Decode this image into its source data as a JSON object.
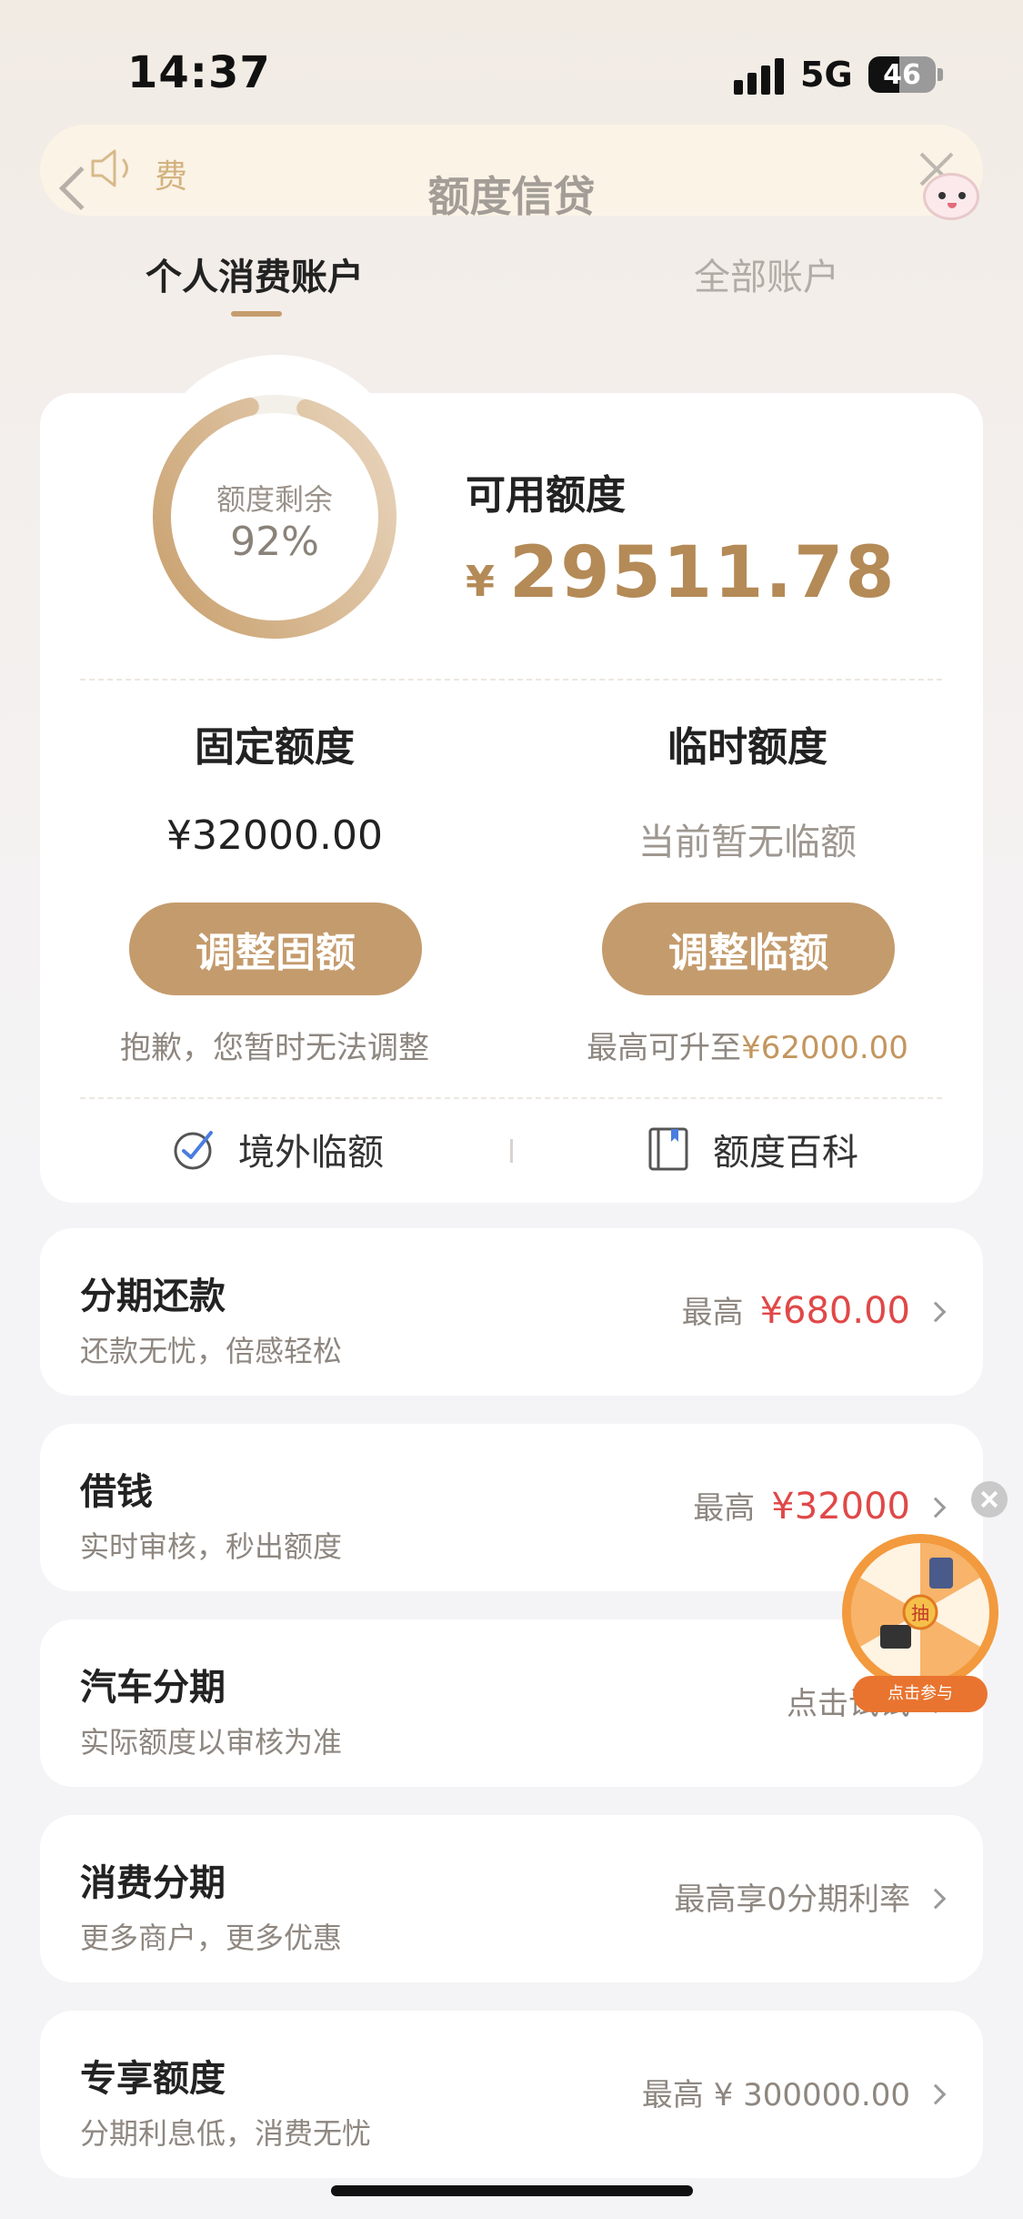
{
  "status_bar": {
    "time": "14:37",
    "network": "5G",
    "battery": "46",
    "battery_level": 0.46
  },
  "header": {
    "notice_text": "费",
    "title": "额度信贷"
  },
  "tabs": [
    {
      "label": "个人消费账户",
      "active": true
    },
    {
      "label": "全部账户",
      "active": false
    }
  ],
  "overview": {
    "ring_label": "额度剩余",
    "ring_percent": "92%",
    "ring_fraction": 0.92,
    "available_label": "可用额度",
    "currency": "¥",
    "available_amount": "29511.78"
  },
  "fixed": {
    "title": "固定额度",
    "value": "¥32000.00",
    "button": "调整固额",
    "note": "抱歉，您暂时无法调整"
  },
  "temporary": {
    "title": "临时额度",
    "value": "当前暂无临额",
    "button": "调整临额",
    "note_prefix": "最高可升至",
    "note_amount": "¥62000.00"
  },
  "links": {
    "overseas": "境外临额",
    "encyclopedia": "额度百科"
  },
  "rows": [
    {
      "title": "分期还款",
      "sub": "还款无忧，倍感轻松",
      "right_prefix": "最高",
      "right_value": "¥680.00"
    },
    {
      "title": "借钱",
      "sub": "实时审核，秒出额度",
      "right_prefix": "最高",
      "right_value": "¥32000"
    },
    {
      "title": "汽车分期",
      "sub": "实际额度以审核为准",
      "right_text": "点击试试"
    },
    {
      "title": "消费分期",
      "sub": "更多商户，更多优惠",
      "right_text": "最高享0分期利率"
    },
    {
      "title": "专享额度",
      "sub": "分期利息低，消费无忧",
      "right_text": "最高 ¥ 300000.00"
    }
  ],
  "floating": {
    "wheel_center": "抽",
    "tag": "点击参与"
  },
  "colors": {
    "gold": "#c49b6c",
    "red": "#e04848"
  }
}
